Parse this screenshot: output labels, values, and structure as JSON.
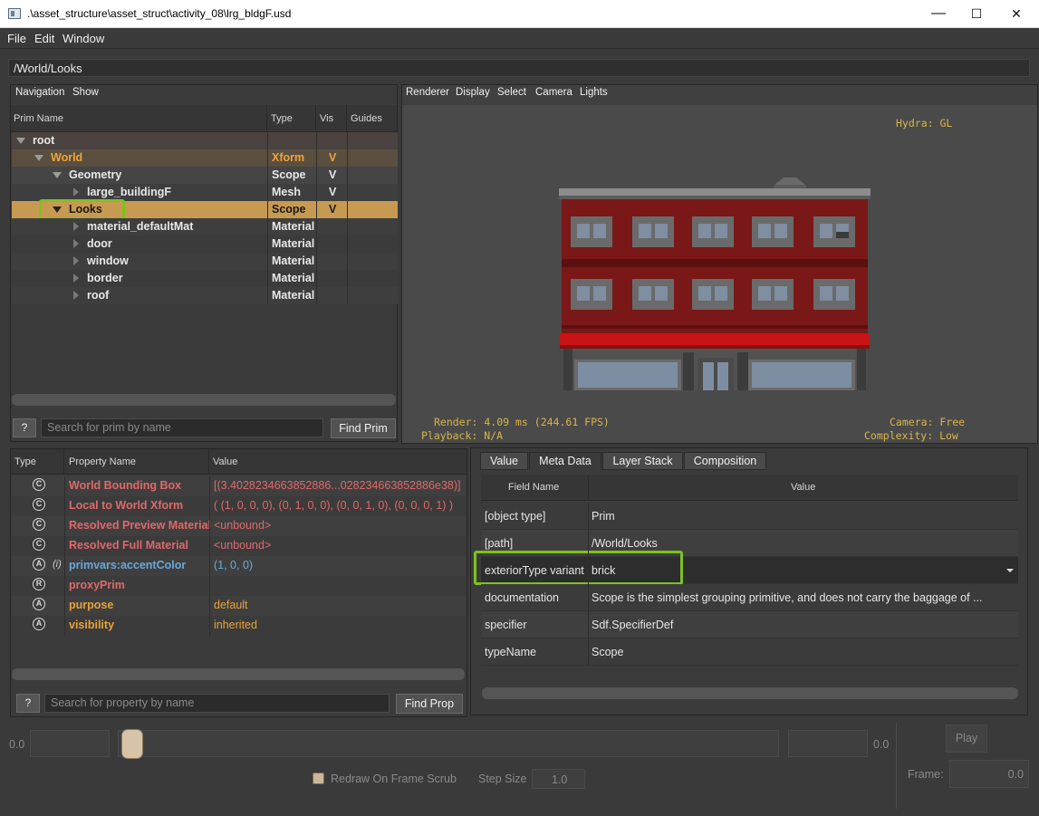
{
  "window": {
    "title": ".\\asset_structure\\asset_struct\\activity_08\\lrg_bldgF.usd",
    "minimize": "—",
    "maximize": "☐",
    "close": "✕"
  },
  "menubar": [
    "File",
    "Edit",
    "Window"
  ],
  "path": "/World/Looks",
  "tree_panel": {
    "menus": [
      "Navigation",
      "Show"
    ],
    "columns": [
      "Prim Name",
      "Type",
      "Vis",
      "Guides"
    ],
    "rows": [
      {
        "name": "root",
        "type": "",
        "vis": ""
      },
      {
        "name": "World",
        "type": "Xform",
        "vis": "V"
      },
      {
        "name": "Geometry",
        "type": "Scope",
        "vis": "V"
      },
      {
        "name": "large_buildingF",
        "type": "Mesh",
        "vis": "V"
      },
      {
        "name": "Looks",
        "type": "Scope",
        "vis": "V"
      },
      {
        "name": "material_defaultMat",
        "type": "Material",
        "vis": ""
      },
      {
        "name": "door",
        "type": "Material",
        "vis": ""
      },
      {
        "name": "window",
        "type": "Material",
        "vis": ""
      },
      {
        "name": "border",
        "type": "Material",
        "vis": ""
      },
      {
        "name": "roof",
        "type": "Material",
        "vis": ""
      }
    ],
    "help_button": "?",
    "search_placeholder": "Search for prim by name",
    "find_button": "Find Prim"
  },
  "viewport": {
    "menus": [
      "Renderer",
      "Display",
      "Select",
      "Camera",
      "Lights"
    ],
    "hud_renderer": "Hydra: GL",
    "hud_render": "Render: 4.09 ms (244.61 FPS)",
    "hud_playback": "Playback: N/A",
    "hud_camera": "Camera: Free",
    "hud_complexity": "Complexity: Low"
  },
  "property_panel": {
    "columns": [
      "Type",
      "Property Name",
      "Value"
    ],
    "rows": [
      {
        "icon": "C",
        "flag": "",
        "name": "World Bounding Box",
        "value": "[(3.4028234663852886...028234663852886e38)]",
        "color": "red"
      },
      {
        "icon": "C",
        "flag": "",
        "name": "Local to World Xform",
        "value": "( (1, 0, 0, 0), (0, 1, 0, 0), (0, 0, 1, 0), (0, 0, 0, 1) )",
        "color": "red"
      },
      {
        "icon": "C",
        "flag": "",
        "name": "Resolved Preview Material",
        "value": "<unbound>",
        "color": "red"
      },
      {
        "icon": "C",
        "flag": "",
        "name": "Resolved Full Material",
        "value": "<unbound>",
        "color": "red"
      },
      {
        "icon": "A",
        "flag": "(i)",
        "name": "primvars:accentColor",
        "value": "(1, 0, 0)",
        "color": "blue"
      },
      {
        "icon": "R",
        "flag": "",
        "name": "proxyPrim",
        "value": "",
        "color": "red"
      },
      {
        "icon": "A",
        "flag": "",
        "name": "purpose",
        "value": "default",
        "color": "orange"
      },
      {
        "icon": "A",
        "flag": "",
        "name": "visibility",
        "value": "inherited",
        "color": "orange"
      }
    ],
    "help_button": "?",
    "search_placeholder": "Search for property by name",
    "find_button": "Find Prop"
  },
  "meta_panel": {
    "tabs": [
      "Value",
      "Meta Data",
      "Layer Stack",
      "Composition"
    ],
    "active_tab": "Meta Data",
    "columns": [
      "Field Name",
      "Value"
    ],
    "rows": [
      {
        "field": "[object type]",
        "value": "Prim"
      },
      {
        "field": "[path]",
        "value": "/World/Looks"
      },
      {
        "field": "exteriorType variant",
        "value": "brick"
      },
      {
        "field": "documentation",
        "value": "Scope is the simplest grouping primitive, and does not carry the baggage of ..."
      },
      {
        "field": "specifier",
        "value": "Sdf.SpecifierDef"
      },
      {
        "field": "typeName",
        "value": "Scope"
      }
    ]
  },
  "timeline": {
    "start_frame": "0.0",
    "end_frame": "0.0",
    "play_button": "Play",
    "redraw_label": "Redraw On Frame Scrub",
    "step_size_label": "Step Size",
    "step_size_value": "1.0",
    "frame_label": "Frame:",
    "frame_value": "0.0"
  },
  "colors": {
    "selection": "#c79a52",
    "highlight_box": "#7dc21e",
    "hud": "#d8b64a"
  }
}
